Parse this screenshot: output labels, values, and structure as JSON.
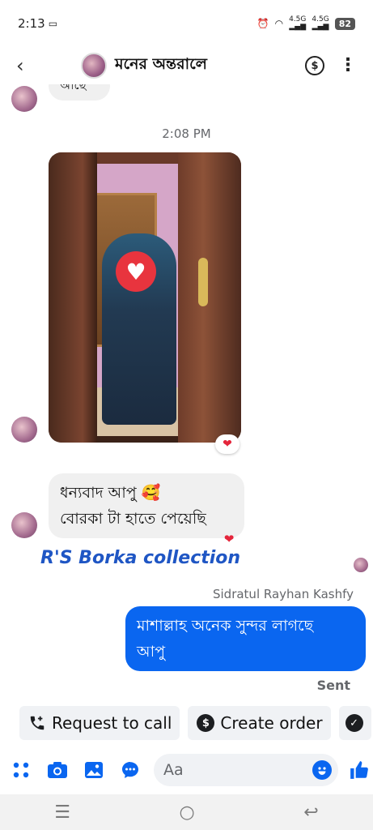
{
  "status_bar": {
    "time": "2:13",
    "network_1": "4.5G",
    "network_2": "4.5G",
    "battery": "82"
  },
  "header": {
    "title": "মনের অন্তরালে",
    "back_icon": "back-arrow-icon",
    "dollar_icon": "dollar-icon",
    "more_icon": "more-vertical-icon"
  },
  "chat": {
    "previous_message": "আছে",
    "timestamp": "2:08 PM",
    "photo_reaction": "❤",
    "incoming_message": {
      "line1": "ধন্যবাদ আপু 🥰",
      "line2": "বোরকা টা হাতে পেয়েছি",
      "reaction": "❤"
    },
    "watermark": "R'S Borka collection",
    "sender_name": "Sidratul Rayhan Kashfy",
    "outgoing_message": {
      "line1": "মাশাল্লাহ অনেক সুন্দর লাগছে",
      "line2": "আপু"
    },
    "status": "Sent"
  },
  "actions": {
    "request_call": "Request to call",
    "create_order": "Create order"
  },
  "composer": {
    "placeholder": "Aa"
  },
  "colors": {
    "accent": "#0a66f0",
    "bubble_in": "#f0f0f0",
    "reaction": "#e4253b"
  }
}
